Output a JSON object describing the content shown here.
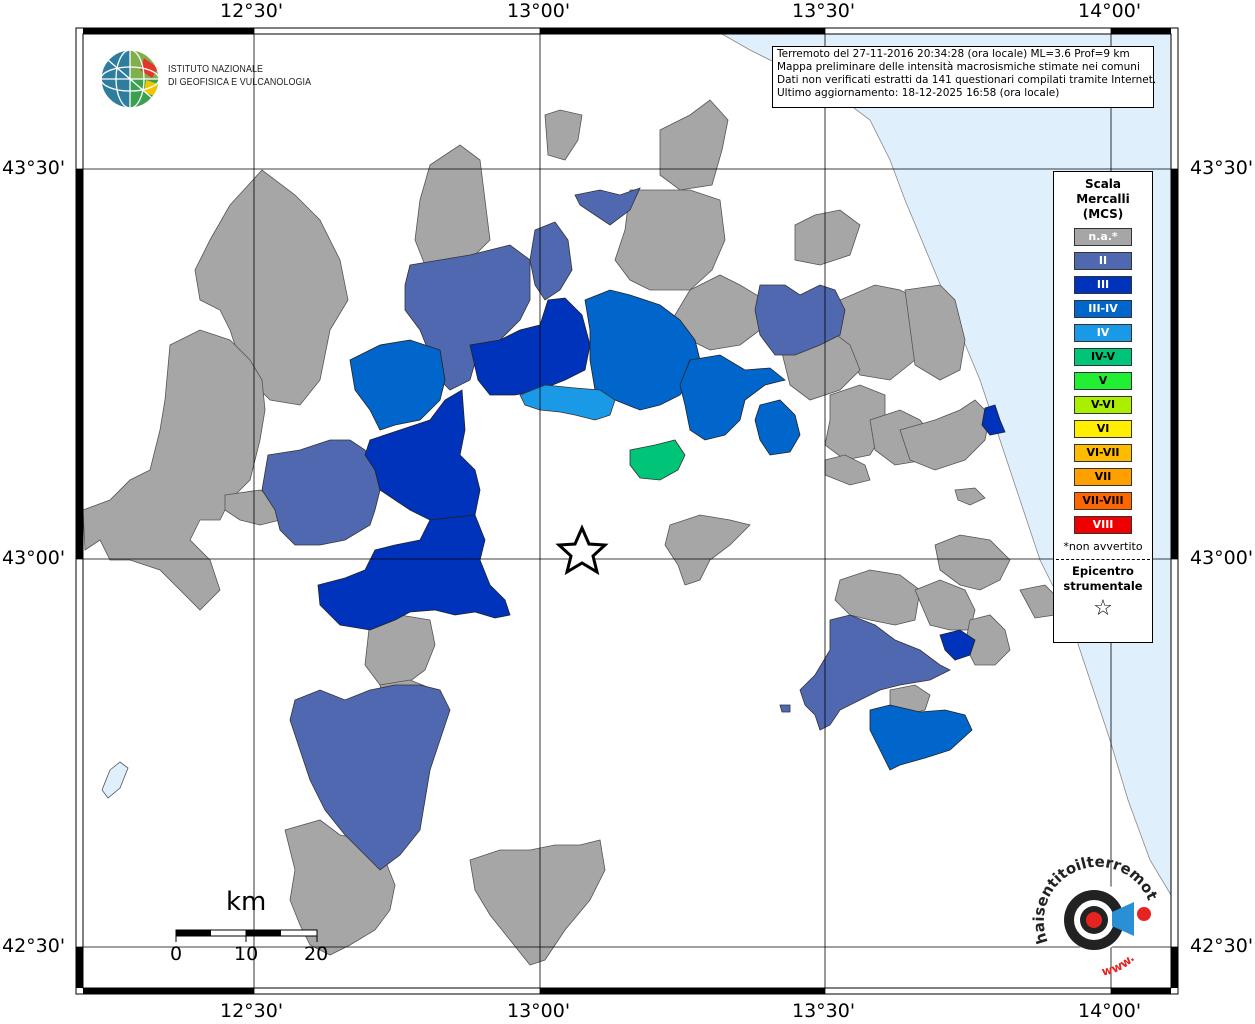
{
  "coords": {
    "top": [
      "12°30'",
      "13°00'",
      "13°30'",
      "14°00'"
    ],
    "bottom": [
      "12°30'",
      "13°00'",
      "13°30'",
      "14°00'"
    ],
    "left": [
      "43°30'",
      "43°00'",
      "42°30'"
    ],
    "right": [
      "43°30'",
      "43°00'",
      "42°30'"
    ]
  },
  "info": {
    "line1": "Terremoto del 27-11-2016 20:34:28 (ora locale) ML=3.6 Prof=9 km",
    "line2": "Mappa preliminare delle intensità macrosismiche stimate nei comuni",
    "line3": "Dati non verificati estratti da 141 questionari compilati tramite Internet.",
    "line4": "Ultimo aggiornamento: 18-12-2025 16:58 (ora locale)"
  },
  "institute": {
    "line1": "ISTITUTO NAZIONALE",
    "line2": "DI GEOFISICA E VULCANOLOGIA"
  },
  "legend": {
    "title1": "Scala",
    "title2": "Mercalli",
    "title3": "(MCS)",
    "items": [
      {
        "label": "n.a.*",
        "color": "#a6a6a6",
        "text": "#ffffff"
      },
      {
        "label": "II",
        "color": "#5068b0",
        "text": "#ffffff"
      },
      {
        "label": "III",
        "color": "#0033bb",
        "text": "#ffffff"
      },
      {
        "label": "III-IV",
        "color": "#0066cc",
        "text": "#ffffff"
      },
      {
        "label": "IV",
        "color": "#1a9ae6",
        "text": "#ffffff"
      },
      {
        "label": "IV-V",
        "color": "#00c477",
        "text": "#000000"
      },
      {
        "label": "V",
        "color": "#22ee33",
        "text": "#000000"
      },
      {
        "label": "V-VI",
        "color": "#aaee00",
        "text": "#000000"
      },
      {
        "label": "VI",
        "color": "#ffee00",
        "text": "#000000"
      },
      {
        "label": "VI-VII",
        "color": "#ffbb00",
        "text": "#000000"
      },
      {
        "label": "VII",
        "color": "#ffa000",
        "text": "#000000"
      },
      {
        "label": "VII-VIII",
        "color": "#ff6600",
        "text": "#000000"
      },
      {
        "label": "VIII",
        "color": "#ee0000",
        "text": "#ffffff"
      }
    ],
    "note": "*non avvertito",
    "epicentro1": "Epicentro",
    "epicentro2": "strumentale",
    "star": "☆"
  },
  "scalebar": {
    "unit": "km",
    "labels": [
      "0",
      "10",
      "20"
    ]
  },
  "colors": {
    "sea": "#dfeffc",
    "na": "#a6a6a6",
    "ii": "#5068b0",
    "iii": "#0033bb",
    "iii_iv": "#0066cc",
    "iv": "#1a9ae6",
    "iv_v": "#00c477"
  },
  "badge": {
    "text": "haisentitoilterremoto.it",
    "url": "www."
  }
}
